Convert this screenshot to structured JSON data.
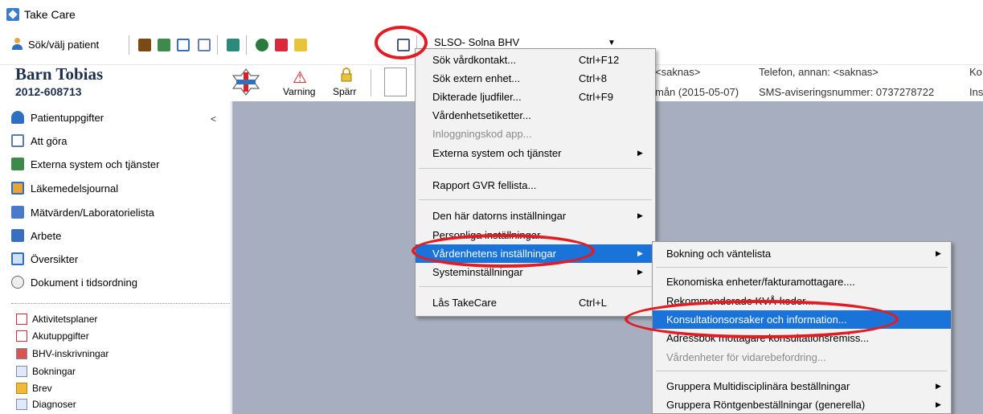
{
  "app": {
    "title": "Take Care"
  },
  "toolbar": {
    "patient_button_label": "Sök/välj patient",
    "unit_select_value": "SLSO- Solna BHV",
    "icons": [
      "book-icon",
      "people-icon",
      "grid-icon",
      "checklist-icon",
      "group-icon",
      "globe-icon",
      "pharmacy-icon",
      "form-icon",
      "computer-icon"
    ]
  },
  "patient": {
    "name": "Barn Tobias",
    "id": "2012-608713",
    "warning_label": "Varning",
    "block_label": "Spärr",
    "info": [
      "<saknas>",
      "Telefon, annan: <saknas>",
      "Ko",
      "mån (2015-05-07)",
      "SMS-aviseringsnummer: 0737278722",
      "Ins"
    ]
  },
  "sidebar": {
    "items": [
      {
        "label": "Patientuppgifter",
        "icon": "person-icon"
      },
      {
        "label": "Att göra",
        "icon": "checkbox-icon"
      },
      {
        "label": "Externa system och tjänster",
        "icon": "people-icon"
      },
      {
        "label": "Läkemedelsjournal",
        "icon": "medicine-icon"
      },
      {
        "label": "Mätvärden/Laboratorielista",
        "icon": "lab-icon"
      },
      {
        "label": "Arbete",
        "icon": "work-icon"
      },
      {
        "label": "Översikter",
        "icon": "table-icon"
      },
      {
        "label": "Dokument i tidsordning",
        "icon": "document-icon"
      }
    ],
    "small_items": [
      {
        "label": "Aktivitetsplaner",
        "icon": "check-icon"
      },
      {
        "label": "Akutuppgifter",
        "icon": "emergency-icon"
      },
      {
        "label": "BHV-inskrivningar",
        "icon": "chart-icon"
      },
      {
        "label": "Bokningar",
        "icon": "calendar-icon"
      },
      {
        "label": "Brev",
        "icon": "folder-icon"
      },
      {
        "label": "Diagnoser",
        "icon": "diagnosis-icon"
      }
    ]
  },
  "menu1": {
    "items": [
      {
        "label": "Sök vårdkontakt...",
        "shortcut": "Ctrl+F12"
      },
      {
        "label": "Sök extern enhet...",
        "shortcut": "Ctrl+8"
      },
      {
        "label": "Dikterade ljudfiler...",
        "shortcut": "Ctrl+F9"
      },
      {
        "label": "Vårdenhetsetiketter..."
      },
      {
        "label": "Inloggningskod app..."
      },
      {
        "label": "Externa system och tjänster"
      },
      {
        "label": "Rapport GVR fellista..."
      },
      {
        "label": "Den här datorns inställningar"
      },
      {
        "label": "Personliga inställningar..."
      },
      {
        "label": "Vårdenhetens inställningar"
      },
      {
        "label": "Systeminställningar"
      },
      {
        "label": "Lås TakeCare",
        "shortcut": "Ctrl+L"
      }
    ]
  },
  "menu2": {
    "items": [
      {
        "label": "Bokning och väntelista"
      },
      {
        "label": "Ekonomiska enheter/fakturamottagare...."
      },
      {
        "label": "Rekommenderade KVÅ-koder..."
      },
      {
        "label": "Konsultationsorsaker och information..."
      },
      {
        "label": "Adressbok mottagare konsultationsremiss..."
      },
      {
        "label": "Vårdenheter för vidarebefordring..."
      },
      {
        "label": "Gruppera Multidisciplinära beställningar"
      },
      {
        "label": "Gruppera Röntgenbeställningar (generella)"
      }
    ]
  },
  "colors": {
    "highlight": "#1a73d9",
    "annotation": "#e31b23",
    "workspace": "#a6aebf"
  }
}
